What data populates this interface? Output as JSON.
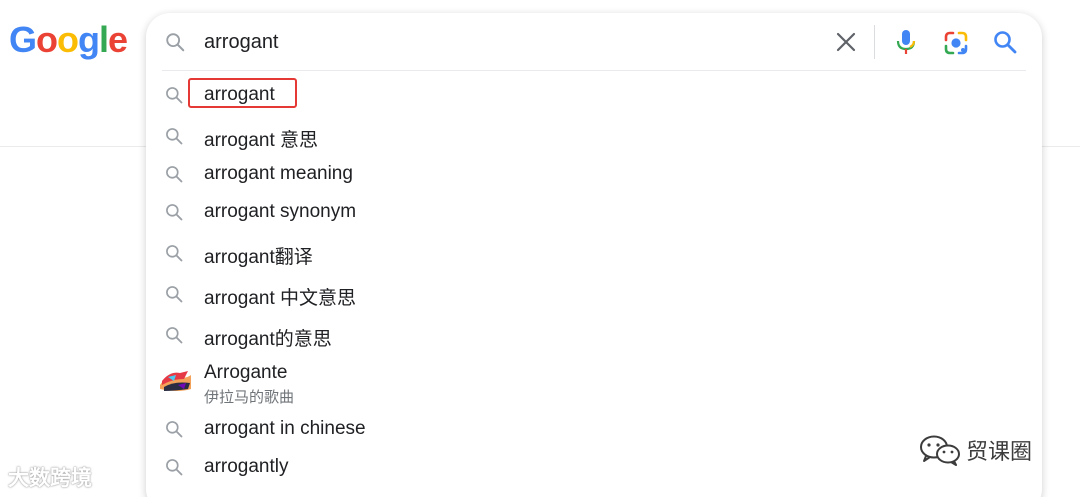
{
  "logo": {
    "letters": [
      "G",
      "o",
      "o",
      "g",
      "l",
      "e"
    ],
    "colors": [
      "#4285f4",
      "#ea4335",
      "#fbbc05",
      "#4285f4",
      "#34a853",
      "#ea4335"
    ]
  },
  "search": {
    "query": "arrogant",
    "clear_icon": "close-icon",
    "voice_icon": "microphone-icon",
    "lens_icon": "camera-lens-icon",
    "submit_icon": "search-icon"
  },
  "suggestions": [
    {
      "text": "arrogant"
    },
    {
      "text": "arrogant 意思"
    },
    {
      "text": "arrogant meaning"
    },
    {
      "text": "arrogant synonym"
    },
    {
      "text": "arrogant翻译"
    },
    {
      "text": "arrogant 中文意思"
    },
    {
      "text": "arrogant的意思"
    },
    {
      "text": "Arrogante",
      "subtitle": "伊拉马的歌曲",
      "thumbnail": "album-thumbnail"
    },
    {
      "text": "arrogant in chinese"
    },
    {
      "text": "arrogantly"
    }
  ],
  "highlight_color": "#e53935",
  "watermarks": {
    "left": "大数跨境",
    "right": "贸课圈"
  }
}
